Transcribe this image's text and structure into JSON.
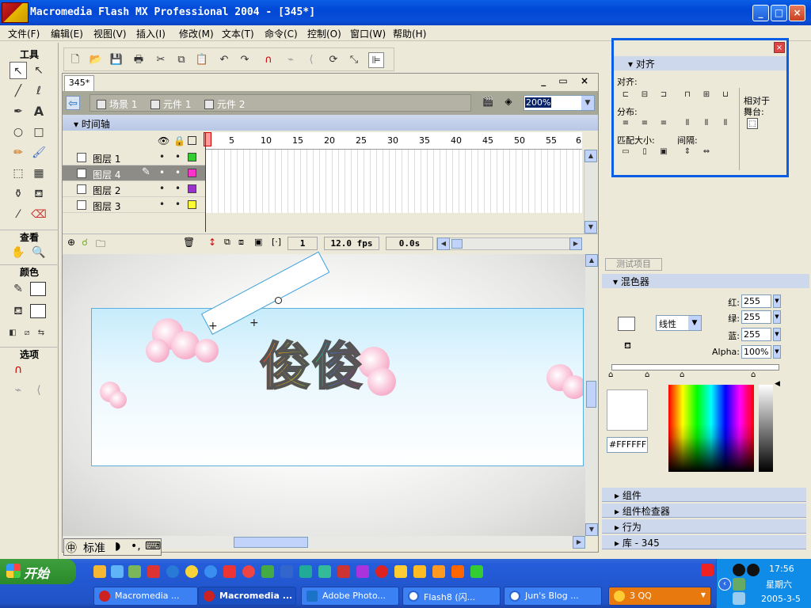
{
  "window": {
    "title": "Macromedia Flash MX Professional 2004 - [345*]"
  },
  "menu": [
    "文件(F)",
    "编辑(E)",
    "视图(V)",
    "插入(I)",
    "修改(M)",
    "文本(T)",
    "命令(C)",
    "控制(O)",
    "窗口(W)",
    "帮助(H)"
  ],
  "tools": {
    "title": "工具",
    "view_title": "查看",
    "colors_title": "颜色",
    "options_title": "选项"
  },
  "document": {
    "tab": "345*",
    "breadcrumbs": [
      "场景 1",
      "元件 1",
      "元件 2"
    ],
    "zoom": "200%"
  },
  "timeline": {
    "title": "时间轴",
    "frame_numbers": [
      "1",
      "5",
      "10",
      "15",
      "20",
      "25",
      "30",
      "35",
      "40",
      "45",
      "50",
      "55",
      "6"
    ],
    "layers": [
      {
        "name": "图层 1",
        "color": "#33cc33",
        "selected": false
      },
      {
        "name": "图层 4",
        "color": "#ff33cc",
        "selected": true
      },
      {
        "name": "图层 2",
        "color": "#9933cc",
        "selected": false
      },
      {
        "name": "图层 3",
        "color": "#ffff33",
        "selected": false
      }
    ],
    "current_frame": "1",
    "fps": "12.0 fps",
    "time": "0.0s"
  },
  "stage": {
    "text": "俊俊"
  },
  "ime": {
    "mode": "标准"
  },
  "align_panel": {
    "title": "对齐",
    "align_label": "对齐:",
    "distribute_label": "分布:",
    "match_label": "匹配大小:",
    "spacing_label": "间隔:",
    "relative_label_1": "相对于",
    "relative_label_2": "舞台:"
  },
  "test_item": "测试项目",
  "mixer": {
    "title": "混色器",
    "fill_type": "线性",
    "red_label": "红:",
    "red": "255",
    "green_label": "绿:",
    "green": "255",
    "blue_label": "蓝:",
    "blue": "255",
    "alpha_label": "Alpha:",
    "alpha": "100%",
    "hex": "#FFFFFF"
  },
  "collapsed_panels": [
    "组件",
    "组件检查器",
    "行为",
    "库 - 345"
  ],
  "taskbar": {
    "start": "开始",
    "buttons": [
      "Macromedia ...",
      "Macromedia ...",
      "Adobe Photo...",
      "Flash8 (闪...",
      "Jun's Blog ...",
      "3 QQ"
    ],
    "time": "17:56",
    "weekday": "星期六",
    "date": "2005-3-5"
  }
}
